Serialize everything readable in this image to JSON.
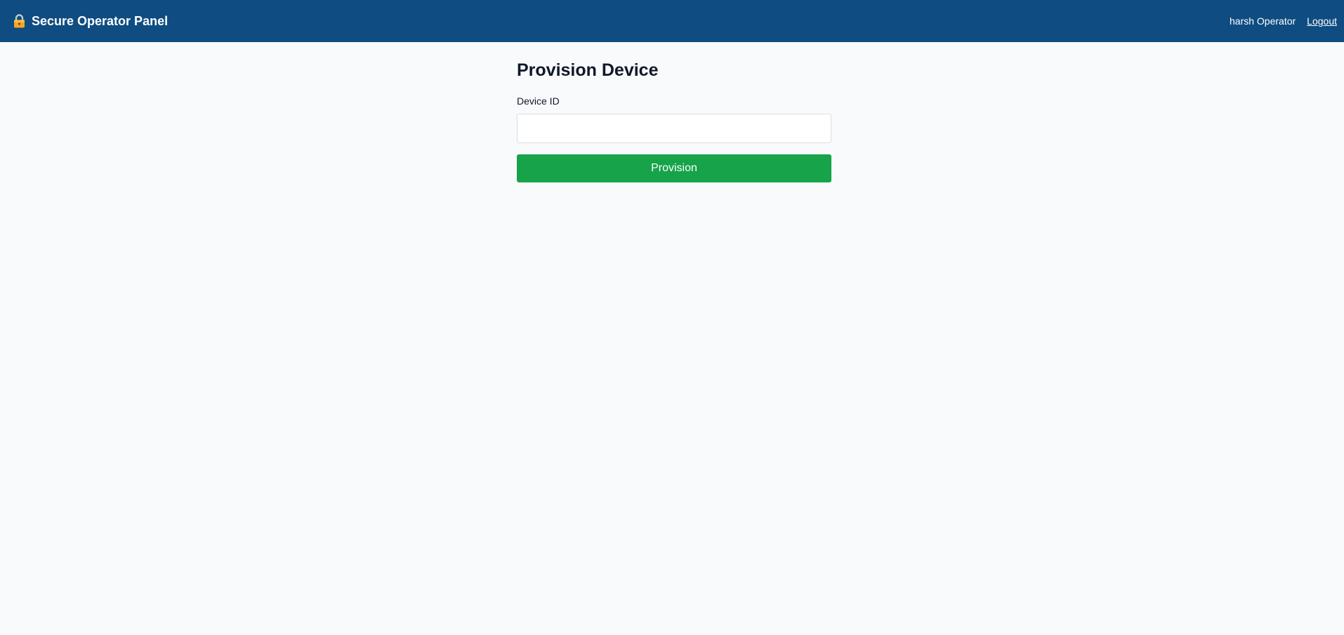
{
  "header": {
    "brand_icon": "lock-icon",
    "title": "Secure Operator Panel",
    "user_name": "harsh Operator",
    "logout_label": "Logout"
  },
  "main": {
    "page_title": "Provision Device",
    "device_id_label": "Device ID",
    "device_id_value": "",
    "device_id_placeholder": "",
    "provision_label": "Provision"
  },
  "colors": {
    "header_bg": "#0f4c81",
    "page_bg": "#f8fafc",
    "primary_button": "#16a34a"
  }
}
